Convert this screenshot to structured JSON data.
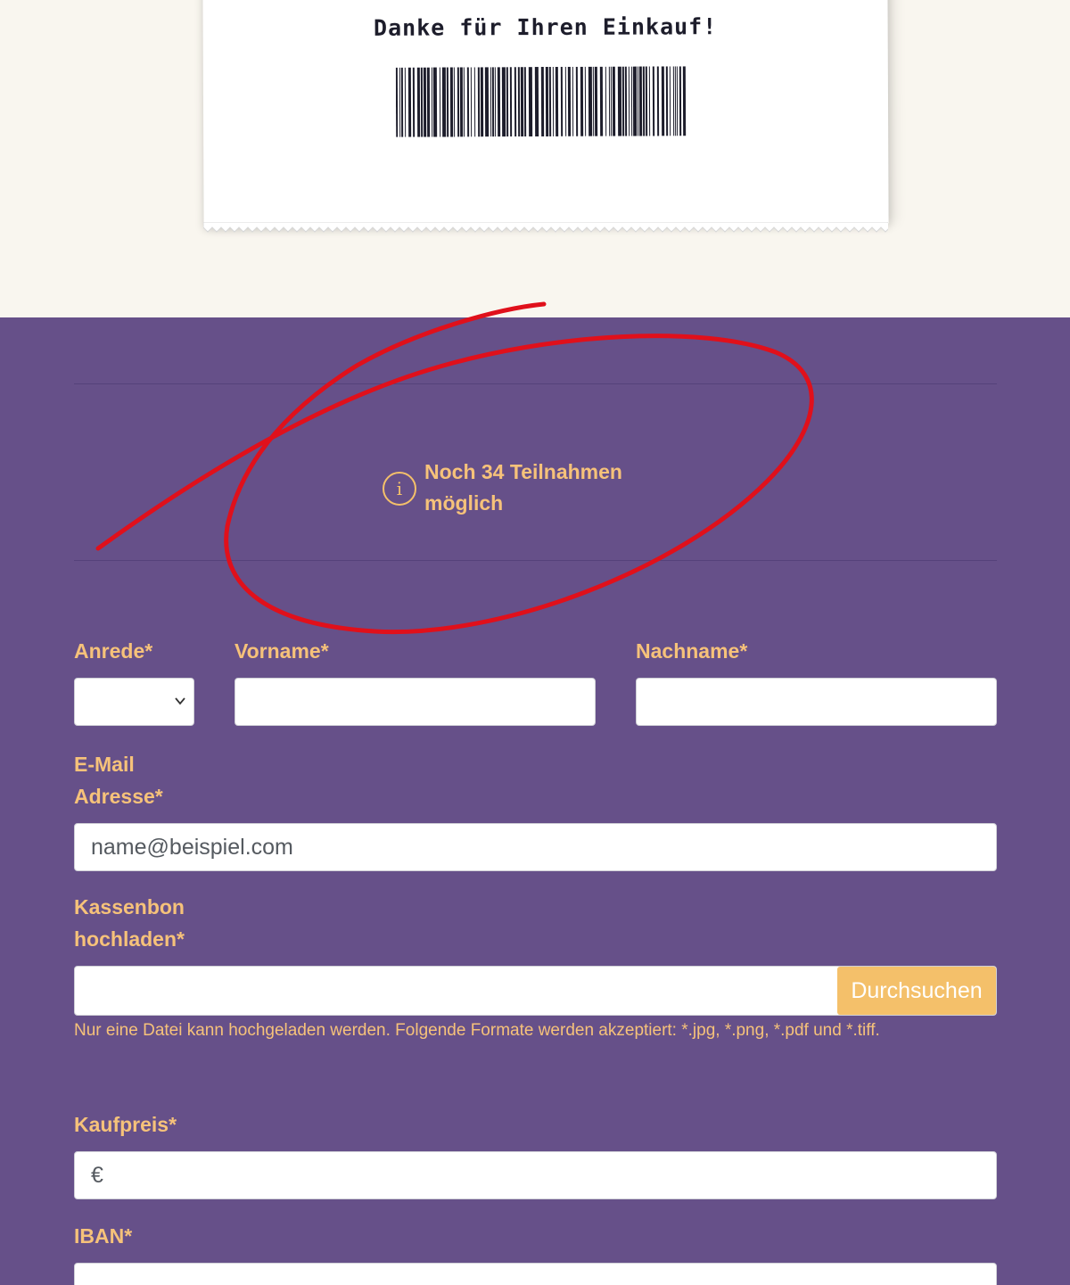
{
  "receipt": {
    "thanks_text": "Danke für Ihren Einkauf!",
    "barcode_icon": "barcode-icon"
  },
  "info": {
    "icon": "info-icon",
    "icon_glyph": "i",
    "text": "Noch 34 Teilnahmen möglich"
  },
  "form": {
    "salutation_label": "Anrede*",
    "salutation_value": "",
    "firstname_label": "Vorname*",
    "firstname_value": "",
    "lastname_label": "Nachname*",
    "lastname_value": "",
    "email_label": "E-Mail Adresse*",
    "email_placeholder": "name@beispiel.com",
    "receipt_label": "Kassenbon hochladen*",
    "browse_label": "Durchsuchen",
    "upload_hint": "Nur eine Datei kann hochgeladen werden. Folgende Formate werden akzeptiert: *.jpg, *.png, *.pdf und *.tiff.",
    "price_label": "Kaufpreis*",
    "price_placeholder": "€",
    "iban_label": "IBAN*",
    "iban_value": ""
  },
  "colors": {
    "cream_background": "#f9f6ef",
    "form_background": "#665089",
    "label_color": "#f6c27a",
    "accent_button": "#f4c06a",
    "dark_purple": "#3e2469",
    "annotation_red": "#e0101b"
  }
}
